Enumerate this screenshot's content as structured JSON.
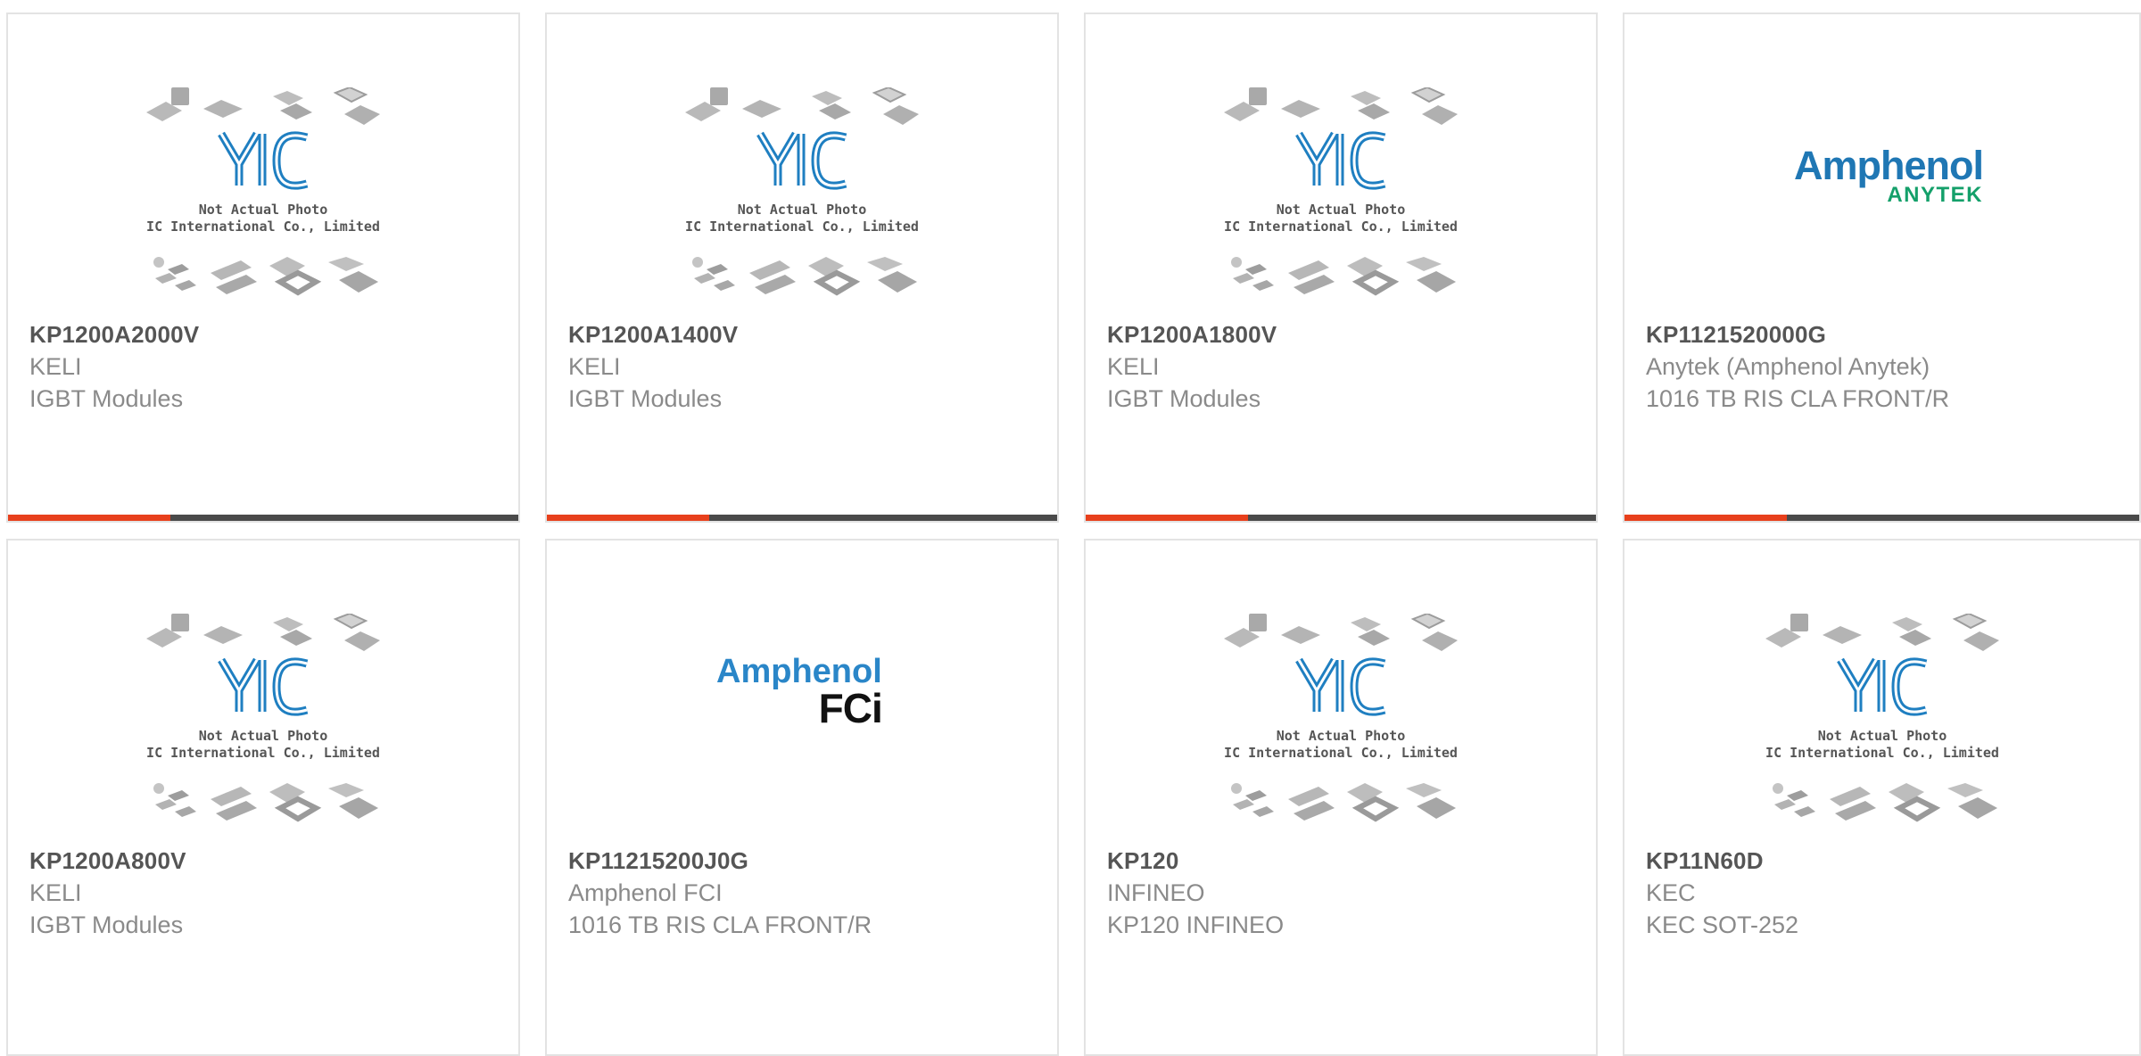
{
  "colors": {
    "accent": "#e8401c",
    "bar": "#4a4a4a",
    "part_number": "#555555",
    "meta": "#8a8a8a",
    "yic_blue": "#1f7fc1"
  },
  "placeholder_image": {
    "line1": "Not Actual Photo",
    "line2": "YIC International Co., Limited.",
    "logo_text": "YIC"
  },
  "brand_logos": {
    "anytek": {
      "word": "Amphenol",
      "sub": "ANYTEK"
    },
    "fci": {
      "word": "Amphenol",
      "sub": "FCi"
    }
  },
  "cards": [
    {
      "part_number": "KP1200A2000V",
      "manufacturer": "KELI",
      "description": "IGBT Modules",
      "image": "placeholder"
    },
    {
      "part_number": "KP1200A1400V",
      "manufacturer": "KELI",
      "description": "IGBT Modules",
      "image": "placeholder"
    },
    {
      "part_number": "KP1200A1800V",
      "manufacturer": "KELI",
      "description": "IGBT Modules",
      "image": "placeholder"
    },
    {
      "part_number": "KP1121520000G",
      "manufacturer": "Anytek (Amphenol Anytek)",
      "description": "1016 TB RIS CLA FRONT/R",
      "image": "amphenol-anytek-logo"
    },
    {
      "part_number": "KP1200A800V",
      "manufacturer": "KELI",
      "description": "IGBT Modules",
      "image": "placeholder"
    },
    {
      "part_number": "KP11215200J0G",
      "manufacturer": "Amphenol FCI",
      "description": "1016 TB RIS CLA FRONT/R",
      "image": "amphenol-fci-logo"
    },
    {
      "part_number": "KP120",
      "manufacturer": "INFINEO",
      "description": "KP120 INFINEO",
      "image": "placeholder"
    },
    {
      "part_number": "KP11N60D",
      "manufacturer": "KEC",
      "description": "KEC SOT-252",
      "image": "placeholder"
    }
  ]
}
